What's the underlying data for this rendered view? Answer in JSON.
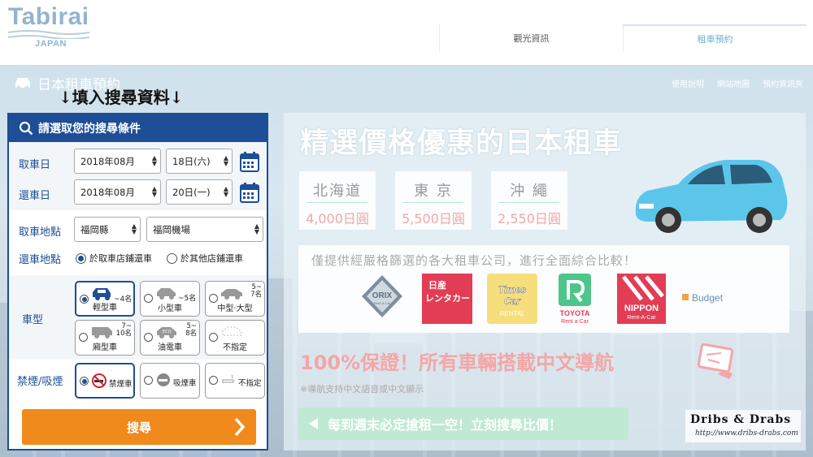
{
  "brand": {
    "name": "Tabirai",
    "sub": "JAPAN"
  },
  "nav": {
    "tabs": [
      {
        "label": "觀光資訊"
      },
      {
        "label": "租車預約"
      }
    ]
  },
  "header": {
    "title": "日本租車預約",
    "links": [
      "使用說明",
      "網站地圖",
      "預約資訊夾"
    ]
  },
  "instruction": "↓填入搜尋資料↓",
  "form": {
    "heading": "請選取您的搜尋條件",
    "pickup_date": {
      "label": "取車日",
      "month": "2018年08月",
      "day": "18日(六)"
    },
    "return_date": {
      "label": "還車日",
      "month": "2018年08月",
      "day": "20日(一)"
    },
    "pickup_place": {
      "label": "取車地點",
      "prefecture": "福岡縣",
      "location": "福岡機場"
    },
    "return_place": {
      "label": "還車地點",
      "options": [
        "於取車店鋪還車",
        "於其他店鋪還車"
      ],
      "selected": 0
    },
    "car_type": {
      "label": "車型",
      "options": [
        {
          "cap": "輕型車",
          "n": "~4名",
          "selected": true
        },
        {
          "cap": "小型車",
          "n": "~5名",
          "selected": false
        },
        {
          "cap": "中型·大型",
          "n": "5~\n7名",
          "selected": false
        },
        {
          "cap": "廂型車",
          "n": "7~\n10名",
          "selected": false
        },
        {
          "cap": "油電車",
          "n": "5~\n8名",
          "selected": false
        },
        {
          "cap": "不指定",
          "n": "",
          "selected": false
        }
      ]
    },
    "smoking": {
      "label": "禁煙/吸煙",
      "options": [
        "禁煙車",
        "吸煙車",
        "不指定"
      ],
      "selected": 0
    },
    "search_label": "搜尋"
  },
  "promo": {
    "title": "精選價格優惠的日本租車",
    "cities": [
      {
        "name": "北海道",
        "price": "4,000日圓"
      },
      {
        "name": "東 京",
        "price": "5,500日圓"
      },
      {
        "name": "沖 繩",
        "price": "2,550日圓"
      }
    ],
    "rentals_title": "僅提供經嚴格篩選的各大租車公司，進行全面綜合比較！",
    "logos": {
      "orix": "ORIX",
      "orix_sub": "Rent-A-Car",
      "nissan1": "日産",
      "nissan2": "レンタカー",
      "times1": "Times",
      "times2": "Car",
      "times3": "RENTAL",
      "toyota1": "TOYOTA",
      "toyota2": "Rent a Car",
      "nippon1": "NIPPON",
      "nippon2": "Rent-A-Car",
      "budget": "Budget"
    },
    "chinese_nav": "100%保證！所有車輛搭載中文導航",
    "nav_note": "※導航支持中文語音或中文顯示",
    "cta": "每到週末必定搶租一空！立刻搜尋比價！"
  },
  "watermark": {
    "name": "Dribs & Drabs",
    "url": "http://www.dribs-drabs.com"
  },
  "colors": {
    "navy": "#1d4e96",
    "orange": "#f08a1c",
    "logo": "#93b4cf"
  }
}
